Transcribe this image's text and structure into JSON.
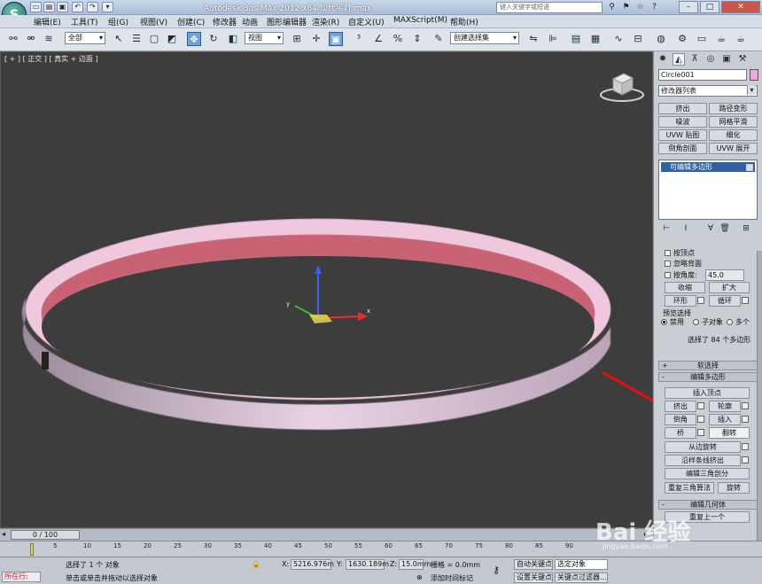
{
  "titlebar": {
    "title": "Autodesk 3ds Max  2012 x64    现代吊灯.max",
    "search_placeholder": "键入关键字或短语"
  },
  "menu": [
    "编辑(E)",
    "工具(T)",
    "组(G)",
    "视图(V)",
    "创建(C)",
    "修改器",
    "动画",
    "图形编辑器",
    "渲染(R)",
    "自定义(U)",
    "MAXScript(M)",
    "帮助(H)"
  ],
  "toolbar": {
    "selection_filter": "全部",
    "coord_system": "视图",
    "named_selection": "创建选择集"
  },
  "viewport": {
    "label": "[ + ] [ 正交 ] [ 真实 + 边面 ]",
    "axis_x": "x",
    "axis_y": "y"
  },
  "command_panel": {
    "object_name": "Circle001",
    "object_color": "#f2a6e0",
    "modifier_list": "修改器列表",
    "modifier_buttons": [
      "挤出",
      "路径变形",
      "噪波",
      "网格平滑",
      "UVW 贴图",
      "细化",
      "倒角剖面",
      "UVW 展开"
    ],
    "stack_item": "可编辑多边形",
    "selection": {
      "by_vertex": "按顶点",
      "ignore_backfacing": "忽略背面",
      "by_angle": "按角度:",
      "angle_value": "45.0",
      "shrink": "收缩",
      "grow": "扩大",
      "ring": "环形",
      "loop": "循环",
      "preview_selection": "预览选择",
      "disabled": "禁用",
      "sub_object": "子对象",
      "multi": "多个",
      "status": "选择了 84 个多边形"
    },
    "soft_selection": "软选择",
    "edit_polygons": "编辑多边形",
    "insert_vertex": "插入顶点",
    "extrude": "挤出",
    "outline": "轮廓",
    "bevel": "倒角",
    "inset": "插入",
    "bridge": "桥",
    "flip": "翻转",
    "hinge_from_edge": "从边旋转",
    "extrude_along_spline": "沿样条线挤出",
    "edit_triangulation": "编辑三角剖分",
    "retriangulate": "重复三角算法",
    "turn": "旋转",
    "edit_geometry": "编辑几何体",
    "repeat_last": "重复上一个"
  },
  "timeline": {
    "slider": "0 / 100",
    "ticks": [
      "5",
      "10",
      "15",
      "20",
      "25",
      "30",
      "35",
      "40",
      "45",
      "50",
      "55",
      "60",
      "65",
      "70",
      "75",
      "80",
      "85",
      "90"
    ]
  },
  "status": {
    "mode": "所在行:",
    "selected": "选择了 1 个 对象",
    "hint": "单击或单击并拖动以选择对象",
    "x_label": "X:",
    "x_value": "5216.976m",
    "y_label": "Y:",
    "y_value": "1630.189m",
    "z_label": "Z:",
    "z_value": "15.0mm",
    "grid": "栅格 = 0.0mm",
    "add_time_tag": "添加时间标记",
    "auto_key": "自动关键点",
    "set_key": "设置关键点",
    "selected_obj": "选定对象",
    "key_filters": "关键点过滤器..."
  },
  "watermark": {
    "brand": "Bai 经验",
    "url": "jingyan.baidu.com"
  }
}
